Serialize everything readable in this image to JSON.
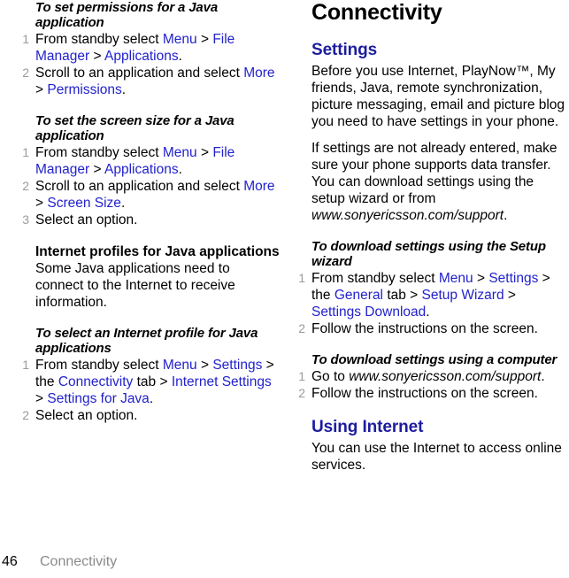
{
  "footer": {
    "page_number": "46",
    "chapter": "Connectivity"
  },
  "left_column": {
    "proc_permissions": {
      "heading": "To set permissions for a Java application",
      "steps": [
        {
          "num": "1",
          "parts": [
            {
              "t": "From standby select ",
              "s": "plain"
            },
            {
              "t": "Menu",
              "s": "link"
            },
            {
              "t": " > ",
              "s": "plain"
            },
            {
              "t": "File Manager",
              "s": "link"
            },
            {
              "t": " > ",
              "s": "plain"
            },
            {
              "t": "Applications",
              "s": "link"
            },
            {
              "t": ".",
              "s": "plain"
            }
          ]
        },
        {
          "num": "2",
          "parts": [
            {
              "t": "Scroll to an application and select ",
              "s": "plain"
            },
            {
              "t": "More",
              "s": "link"
            },
            {
              "t": " > ",
              "s": "plain"
            },
            {
              "t": "Permissions",
              "s": "link"
            },
            {
              "t": ".",
              "s": "plain"
            }
          ]
        }
      ]
    },
    "proc_screen_size": {
      "heading": "To set the screen size for a Java application",
      "steps": [
        {
          "num": "1",
          "parts": [
            {
              "t": "From standby select ",
              "s": "plain"
            },
            {
              "t": "Menu",
              "s": "link"
            },
            {
              "t": " > ",
              "s": "plain"
            },
            {
              "t": "File Manager",
              "s": "link"
            },
            {
              "t": " > ",
              "s": "plain"
            },
            {
              "t": "Applications",
              "s": "link"
            },
            {
              "t": ".",
              "s": "plain"
            }
          ]
        },
        {
          "num": "2",
          "parts": [
            {
              "t": "Scroll to an application and select ",
              "s": "plain"
            },
            {
              "t": "More",
              "s": "link"
            },
            {
              "t": " > ",
              "s": "plain"
            },
            {
              "t": "Screen Size",
              "s": "link"
            },
            {
              "t": ".",
              "s": "plain"
            }
          ]
        },
        {
          "num": "3",
          "parts": [
            {
              "t": "Select an option.",
              "s": "plain"
            }
          ]
        }
      ]
    },
    "internet_profiles": {
      "heading": "Internet profiles for Java applications",
      "body": "Some Java applications need to connect to the Internet to receive information."
    },
    "proc_select_profile": {
      "heading": "To select an Internet profile for Java applications",
      "steps": [
        {
          "num": "1",
          "parts": [
            {
              "t": "From standby select ",
              "s": "plain"
            },
            {
              "t": "Menu",
              "s": "link"
            },
            {
              "t": " > ",
              "s": "plain"
            },
            {
              "t": "Settings",
              "s": "link"
            },
            {
              "t": " > the ",
              "s": "plain"
            },
            {
              "t": "Connectivity",
              "s": "link"
            },
            {
              "t": " tab > ",
              "s": "plain"
            },
            {
              "t": "Internet Settings",
              "s": "link"
            },
            {
              "t": " > ",
              "s": "plain"
            },
            {
              "t": "Settings for Java",
              "s": "link"
            },
            {
              "t": ".",
              "s": "plain"
            }
          ]
        },
        {
          "num": "2",
          "parts": [
            {
              "t": "Select an option.",
              "s": "plain"
            }
          ]
        }
      ]
    }
  },
  "right_column": {
    "chapter_title": "Connectivity",
    "settings": {
      "heading": "Settings",
      "para1": "Before you use Internet, PlayNow™, My friends, Java, remote synchronization, picture messaging, email and picture blog you need to have settings in your phone.",
      "para2_parts": [
        {
          "t": "If settings are not already entered, make sure your phone supports data transfer. You can download settings using the setup wizard or from ",
          "s": "plain"
        },
        {
          "t": "www.sonyericsson.com/support",
          "s": "italic"
        },
        {
          "t": ".",
          "s": "plain"
        }
      ]
    },
    "proc_setup_wizard": {
      "heading": "To download settings using the Setup wizard",
      "steps": [
        {
          "num": "1",
          "parts": [
            {
              "t": "From standby select ",
              "s": "plain"
            },
            {
              "t": "Menu",
              "s": "link"
            },
            {
              "t": " > ",
              "s": "plain"
            },
            {
              "t": "Settings",
              "s": "link"
            },
            {
              "t": " > the ",
              "s": "plain"
            },
            {
              "t": "General",
              "s": "link"
            },
            {
              "t": " tab > ",
              "s": "plain"
            },
            {
              "t": "Setup Wizard",
              "s": "link"
            },
            {
              "t": " > ",
              "s": "plain"
            },
            {
              "t": "Settings Download",
              "s": "link"
            },
            {
              "t": ".",
              "s": "plain"
            }
          ]
        },
        {
          "num": "2",
          "parts": [
            {
              "t": "Follow the instructions on the screen.",
              "s": "plain"
            }
          ]
        }
      ]
    },
    "proc_computer": {
      "heading": "To download settings using a computer",
      "steps": [
        {
          "num": "1",
          "parts": [
            {
              "t": "Go to ",
              "s": "plain"
            },
            {
              "t": "www.sonyericsson.com/support",
              "s": "italic"
            },
            {
              "t": ".",
              "s": "plain"
            }
          ]
        },
        {
          "num": "2",
          "parts": [
            {
              "t": "Follow the instructions on the screen.",
              "s": "plain"
            }
          ]
        }
      ]
    },
    "using_internet": {
      "heading": "Using Internet",
      "body": "You can use the Internet to access online services."
    }
  },
  "colors": {
    "link_blue": "#2222cc",
    "heading_blue": "#1d1d9e",
    "step_number_gray": "#9b9b9b",
    "footer_gray": "#8a8a8a"
  }
}
